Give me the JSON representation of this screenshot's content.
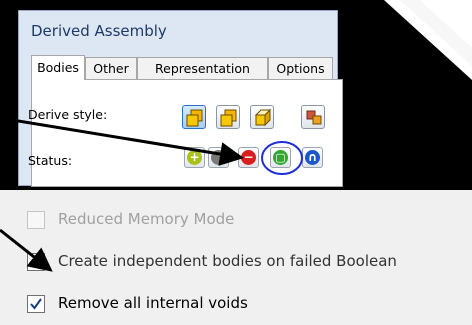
{
  "dialog": {
    "title": "Derived Assembly",
    "tabs": [
      {
        "label": "Bodies",
        "active": true
      },
      {
        "label": "Other",
        "active": false
      },
      {
        "label": "Representation",
        "active": false
      },
      {
        "label": "Options",
        "active": false
      }
    ],
    "derive_style_label": "Derive style:",
    "status_label": "Status:",
    "derive_style_buttons": [
      "merge-no-seams-icon",
      "merge-seams-icon",
      "single-solid-icon",
      "multi-body-icon"
    ],
    "status_buttons": [
      {
        "icon": "include-icon",
        "glyph": "+",
        "color": "#a9c21b"
      },
      {
        "icon": "exclude-grey-icon",
        "glyph": "",
        "color": "#7a7a7a"
      },
      {
        "icon": "subtract-icon",
        "glyph": "−",
        "color": "#d81e1e"
      },
      {
        "icon": "bounding-box-icon",
        "glyph": "▢",
        "color": "#2fa82f"
      },
      {
        "icon": "surface-icon",
        "glyph": "∩",
        "color": "#1c57c9"
      }
    ]
  },
  "options": {
    "reduced_memory": {
      "label": "Reduced Memory Mode",
      "checked": false,
      "enabled": false
    },
    "independent_bodies": {
      "label": "Create independent bodies on failed Boolean",
      "checked": false,
      "enabled": true
    },
    "remove_voids": {
      "label": "Remove all internal voids",
      "checked": true,
      "enabled": true
    }
  },
  "colors": {
    "dialog_bg": "#dde6f3",
    "title_text": "#1e3a66",
    "highlight_circle": "#1e2fd8",
    "annotation_arrow": "#000000",
    "disabled_text": "#a0a0a0"
  }
}
